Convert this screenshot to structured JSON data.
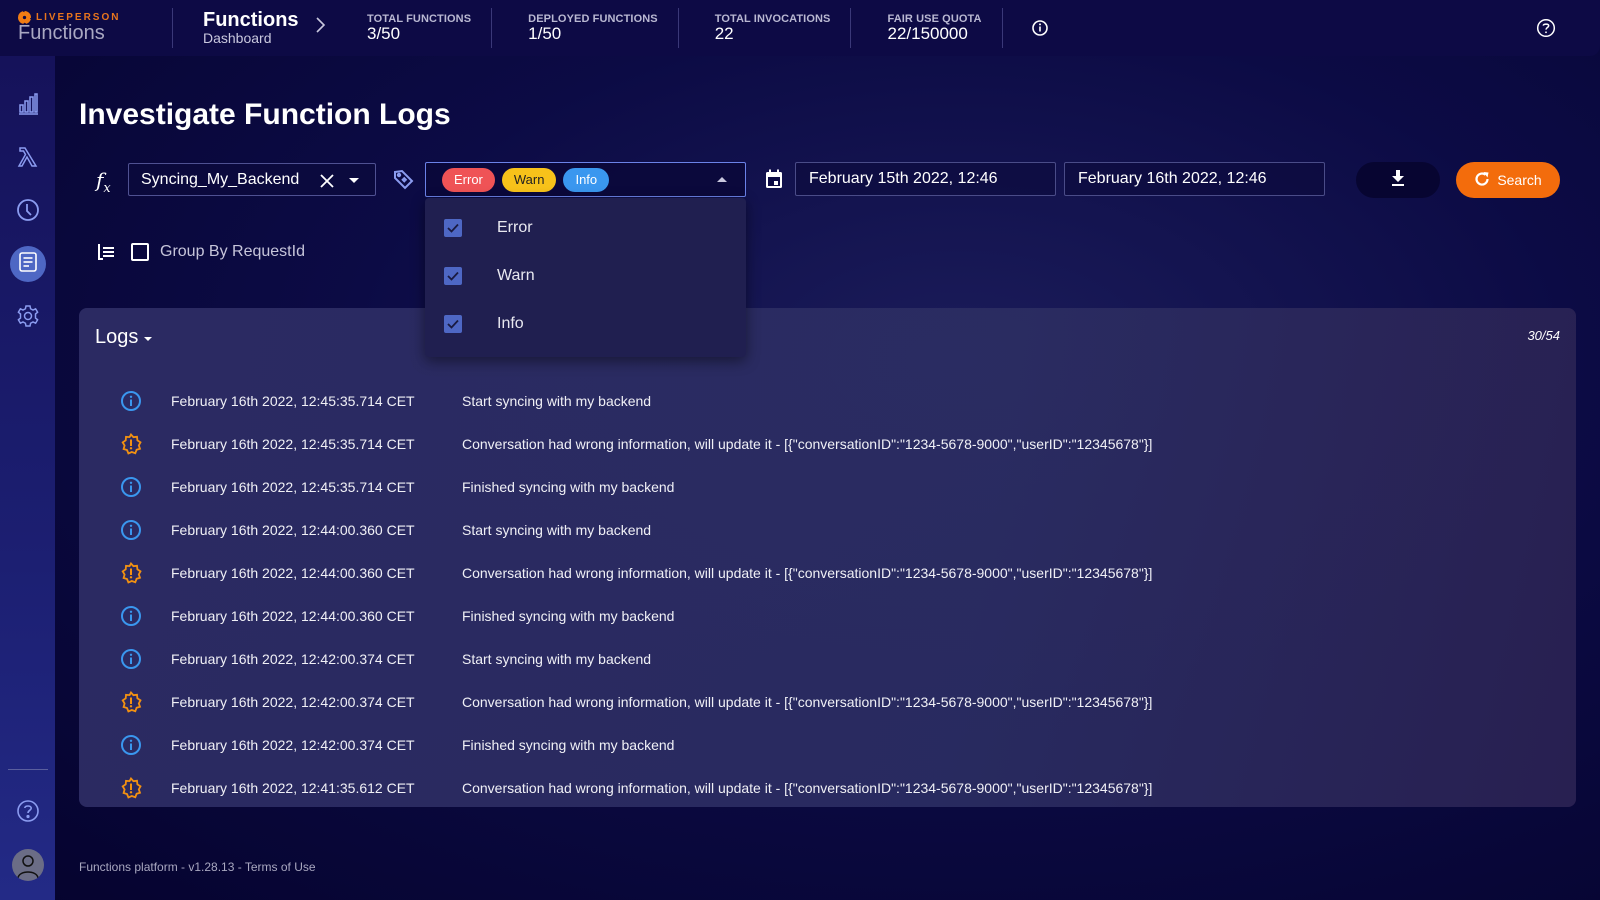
{
  "brand": {
    "company": "LIVEPERSON",
    "product": "Functions"
  },
  "breadcrumb": {
    "title": "Functions",
    "subtitle": "Dashboard"
  },
  "stats": [
    {
      "label": "TOTAL FUNCTIONS",
      "value": "3/50"
    },
    {
      "label": "DEPLOYED FUNCTIONS",
      "value": "1/50"
    },
    {
      "label": "TOTAL INVOCATIONS",
      "value": "22"
    },
    {
      "label": "FAIR USE QUOTA",
      "value": "22/150000"
    }
  ],
  "sidebar": {
    "items": [
      {
        "icon": "bar-chart-icon",
        "label": "Dashboard"
      },
      {
        "icon": "lambda-icon",
        "label": "Functions"
      },
      {
        "icon": "clock-icon",
        "label": "Schedules"
      },
      {
        "icon": "document-icon",
        "label": "Logs",
        "active": true
      },
      {
        "icon": "gear-icon",
        "label": "Settings"
      }
    ]
  },
  "page": {
    "title": "Investigate Function Logs"
  },
  "filters": {
    "function_icon": "fx",
    "function_value": "Syncing_My_Backend",
    "levels": [
      {
        "label": "Error",
        "color": "#ef5356"
      },
      {
        "label": "Warn",
        "color": "#f7c21a"
      },
      {
        "label": "Info",
        "color": "#3a97ef"
      }
    ],
    "date_from": "February 15th 2022, 12:46",
    "date_to": "February 16th 2022, 12:46",
    "search_label": "Search",
    "group_by_label": "Group By RequestId",
    "group_by_checked": false
  },
  "dropdown": {
    "open": true,
    "options": [
      {
        "label": "Error",
        "checked": true
      },
      {
        "label": "Warn",
        "checked": true
      },
      {
        "label": "Info",
        "checked": true
      }
    ]
  },
  "logs": {
    "title": "Logs",
    "count": "30/54",
    "rows": [
      {
        "level": "info",
        "timestamp": "February 16th 2022, 12:45:35.714 CET",
        "message": "Start syncing with my backend"
      },
      {
        "level": "warn",
        "timestamp": "February 16th 2022, 12:45:35.714 CET",
        "message": "Conversation had wrong information, will update it - [{\"conversationID\":\"1234-5678-9000\",\"userID\":\"12345678\"}]"
      },
      {
        "level": "info",
        "timestamp": "February 16th 2022, 12:45:35.714 CET",
        "message": "Finished syncing with my backend"
      },
      {
        "level": "info",
        "timestamp": "February 16th 2022, 12:44:00.360 CET",
        "message": "Start syncing with my backend"
      },
      {
        "level": "warn",
        "timestamp": "February 16th 2022, 12:44:00.360 CET",
        "message": "Conversation had wrong information, will update it - [{\"conversationID\":\"1234-5678-9000\",\"userID\":\"12345678\"}]"
      },
      {
        "level": "info",
        "timestamp": "February 16th 2022, 12:44:00.360 CET",
        "message": "Finished syncing with my backend"
      },
      {
        "level": "info",
        "timestamp": "February 16th 2022, 12:42:00.374 CET",
        "message": "Start syncing with my backend"
      },
      {
        "level": "warn",
        "timestamp": "February 16th 2022, 12:42:00.374 CET",
        "message": "Conversation had wrong information, will update it - [{\"conversationID\":\"1234-5678-9000\",\"userID\":\"12345678\"}]"
      },
      {
        "level": "info",
        "timestamp": "February 16th 2022, 12:42:00.374 CET",
        "message": "Finished syncing with my backend"
      },
      {
        "level": "warn",
        "timestamp": "February 16th 2022, 12:41:35.612 CET",
        "message": "Conversation had wrong information, will update it - [{\"conversationID\":\"1234-5678-9000\",\"userID\":\"12345678\"}]"
      }
    ]
  },
  "footer": {
    "text": "Functions platform - v1.28.13 - Terms of Use"
  },
  "colors": {
    "accent": "#f36c0c",
    "info": "#3a97ef",
    "warn": "#f29111",
    "active_nav": "#4e67c4"
  }
}
